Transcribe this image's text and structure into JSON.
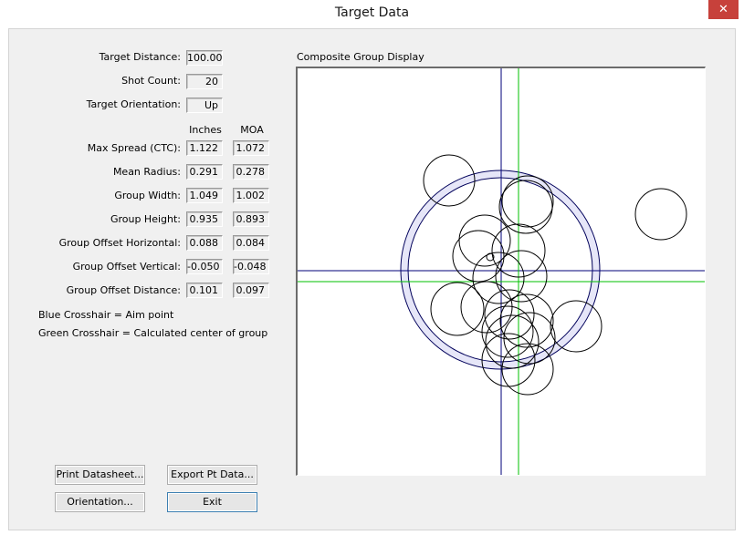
{
  "window": {
    "title": "Target Data",
    "close_glyph": "✕"
  },
  "fields": {
    "target_distance": {
      "label": "Target Distance:",
      "value": "100.00"
    },
    "shot_count": {
      "label": "Shot Count:",
      "value": "20"
    },
    "target_orientation": {
      "label": "Target Orientation:",
      "value": "Up"
    }
  },
  "columns": {
    "inches": "Inches",
    "moa": "MOA"
  },
  "stats": [
    {
      "label": "Max Spread (CTC):",
      "inches": "1.122",
      "moa": "1.072"
    },
    {
      "label": "Mean Radius:",
      "inches": "0.291",
      "moa": "0.278"
    },
    {
      "label": "Group Width:",
      "inches": "1.049",
      "moa": "1.002"
    },
    {
      "label": "Group Height:",
      "inches": "0.935",
      "moa": "0.893"
    },
    {
      "label": "Group Offset Horizontal:",
      "inches": "0.088",
      "moa": "0.084"
    },
    {
      "label": "Group Offset Vertical:",
      "inches": "-0.050",
      "moa": "-0.048"
    },
    {
      "label": "Group Offset Distance:",
      "inches": "0.101",
      "moa": "0.097"
    }
  ],
  "legend": {
    "blue": "Blue Crosshair = Aim point",
    "green": "Green Crosshair = Calculated center of group"
  },
  "buttons": {
    "print": "Print Datasheet...",
    "export": "Export Pt Data...",
    "orientation": "Orientation...",
    "exit": "Exit"
  },
  "display": {
    "label": "Composite Group Display",
    "colors": {
      "aim": "#00007a",
      "center": "#00c000",
      "ring_fill": "#e6e6f8",
      "ring_stroke": "#00005a",
      "hole": "#000000"
    }
  }
}
